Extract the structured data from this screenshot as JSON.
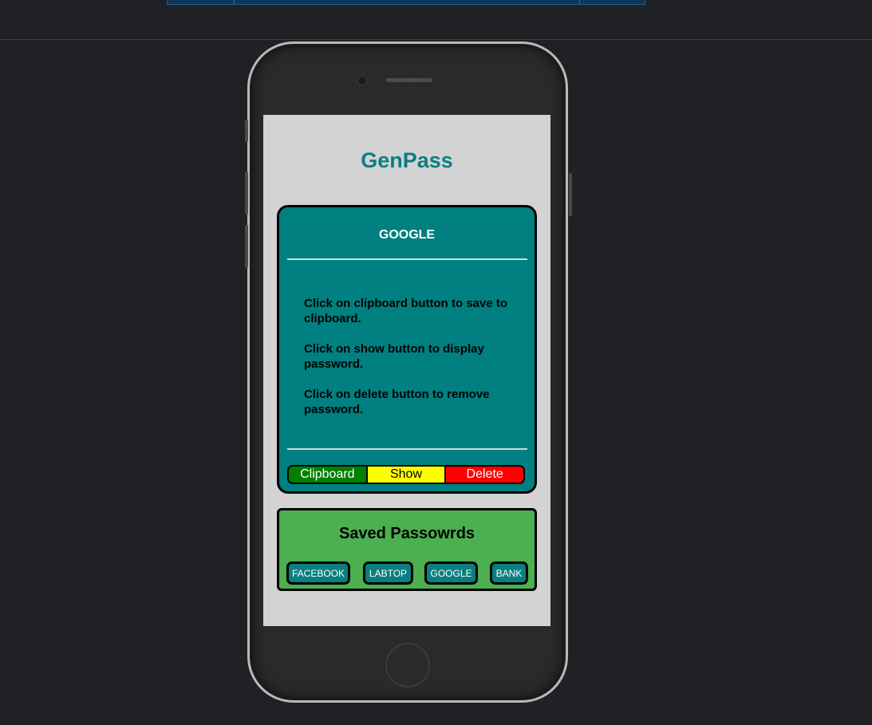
{
  "app": {
    "title": "GenPass"
  },
  "card": {
    "title": "GOOGLE",
    "instructions": [
      "Click on clipboard button to save to clipboard.",
      "Click on show button to display password.",
      "Click on delete button to remove password."
    ],
    "buttons": {
      "clipboard": "Clipboard",
      "show": "Show",
      "delete": "Delete"
    }
  },
  "saved": {
    "title": "Saved Passowrds",
    "items": [
      "FACEBOOK",
      "LABTOP",
      "GOOGLE",
      "BANK"
    ]
  },
  "colors": {
    "accent_teal": "#008080",
    "clipboard_green": "#008000",
    "show_yellow": "#ffff00",
    "delete_red": "#ff0000",
    "saved_panel_green": "#4caf50"
  }
}
